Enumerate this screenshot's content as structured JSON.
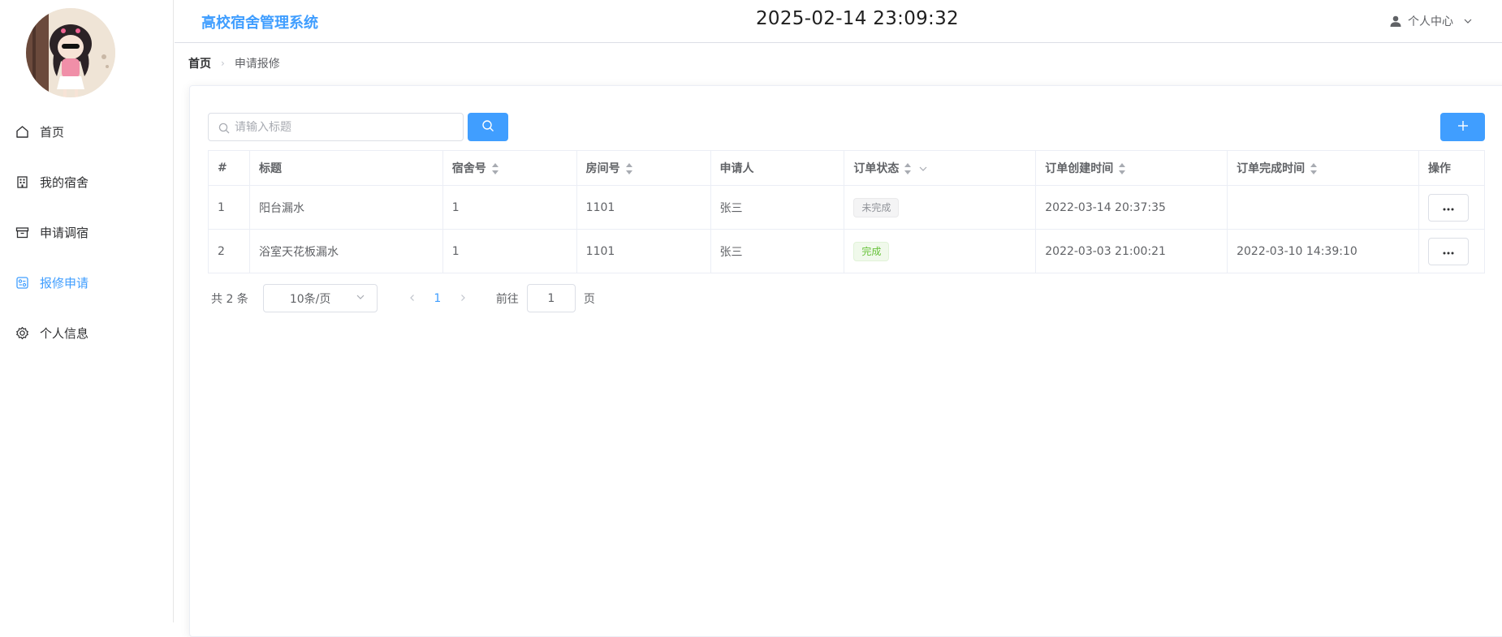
{
  "header": {
    "app_title": "高校宿舍管理系统",
    "datetime": "2025-02-14 23:09:32",
    "user_menu_label": "个人中心"
  },
  "sidebar": {
    "items": [
      {
        "label": "首页",
        "icon": "home-icon",
        "active": false
      },
      {
        "label": "我的宿舍",
        "icon": "building-icon",
        "active": false
      },
      {
        "label": "申请调宿",
        "icon": "box-icon",
        "active": false
      },
      {
        "label": "报修申请",
        "icon": "repair-form-icon",
        "active": true
      },
      {
        "label": "个人信息",
        "icon": "gear-icon",
        "active": false
      }
    ]
  },
  "breadcrumb": {
    "home": "首页",
    "separator": "›",
    "current": "申请报修"
  },
  "search": {
    "placeholder": "请输入标题",
    "value": ""
  },
  "add_button_label": "+",
  "table": {
    "columns": [
      "#",
      "标题",
      "宿舍号",
      "房间号",
      "申请人",
      "订单状态",
      "订单创建时间",
      "订单完成时间",
      "操作"
    ],
    "rows": [
      {
        "index": "1",
        "title": "阳台漏水",
        "dorm": "1",
        "room": "1101",
        "applicant": "张三",
        "status": "未完成",
        "status_type": "info",
        "created": "2022-03-14 20:37:35",
        "finished": ""
      },
      {
        "index": "2",
        "title": "浴室天花板漏水",
        "dorm": "1",
        "room": "1101",
        "applicant": "张三",
        "status": "完成",
        "status_type": "success",
        "created": "2022-03-03 21:00:21",
        "finished": "2022-03-10 14:39:10"
      }
    ]
  },
  "pagination": {
    "total_text": "共 2 条",
    "page_size": "10条/页",
    "current_page": "1",
    "goto_label": "前往",
    "goto_value": "1",
    "page_suffix": "页"
  },
  "colors": {
    "primary": "#409eff",
    "success": "#67c23a",
    "info": "#909399"
  }
}
